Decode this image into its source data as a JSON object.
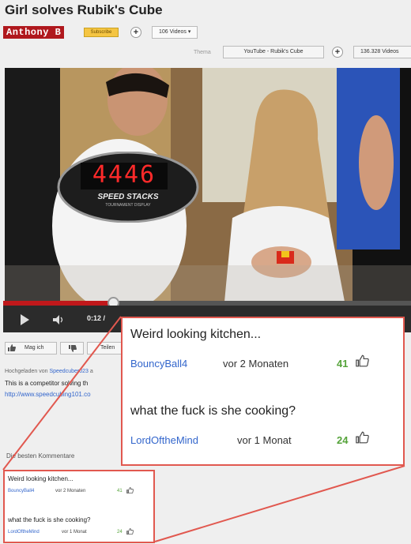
{
  "video": {
    "title": "Girl solves Rubik's Cube",
    "time": "0:12 /"
  },
  "channel": {
    "name": "Anthony B",
    "subscribe_label": "Subscribe",
    "videos_label": "106 Videos ▾"
  },
  "topic": {
    "label": "Thema",
    "name": "YouTube - Rubik's Cube",
    "views": "136.328 Videos"
  },
  "overlay": {
    "timer_display": "4446",
    "timer_brand": "SPEED STACKS",
    "timer_sub": "TOURNAMENT DISPLAY"
  },
  "actions": {
    "like_label": "Mag ich",
    "share_label": "Teilen"
  },
  "description": {
    "uploaded_prefix": "Hochgeladen von",
    "uploader": "Speedcuber023",
    "uploaded_suffix": "a",
    "line1": "This is a competitor solving th",
    "link": "http://www.speedcubing101.co"
  },
  "comments_section": {
    "label": "Die besten Kommentare"
  },
  "comments": [
    {
      "text": "Weird looking kitchen...",
      "user": "BouncyBall4",
      "time": "vor 2 Monaten",
      "votes": "41"
    },
    {
      "text": "what the fuck is she cooking?",
      "user": "LordOftheMind",
      "time": "vor 1 Monat",
      "votes": "24"
    }
  ],
  "colors": {
    "highlight_border": "#e1584f",
    "link_blue": "#3366cc",
    "vote_green": "#55a33a",
    "channel_red": "#b0181d"
  }
}
